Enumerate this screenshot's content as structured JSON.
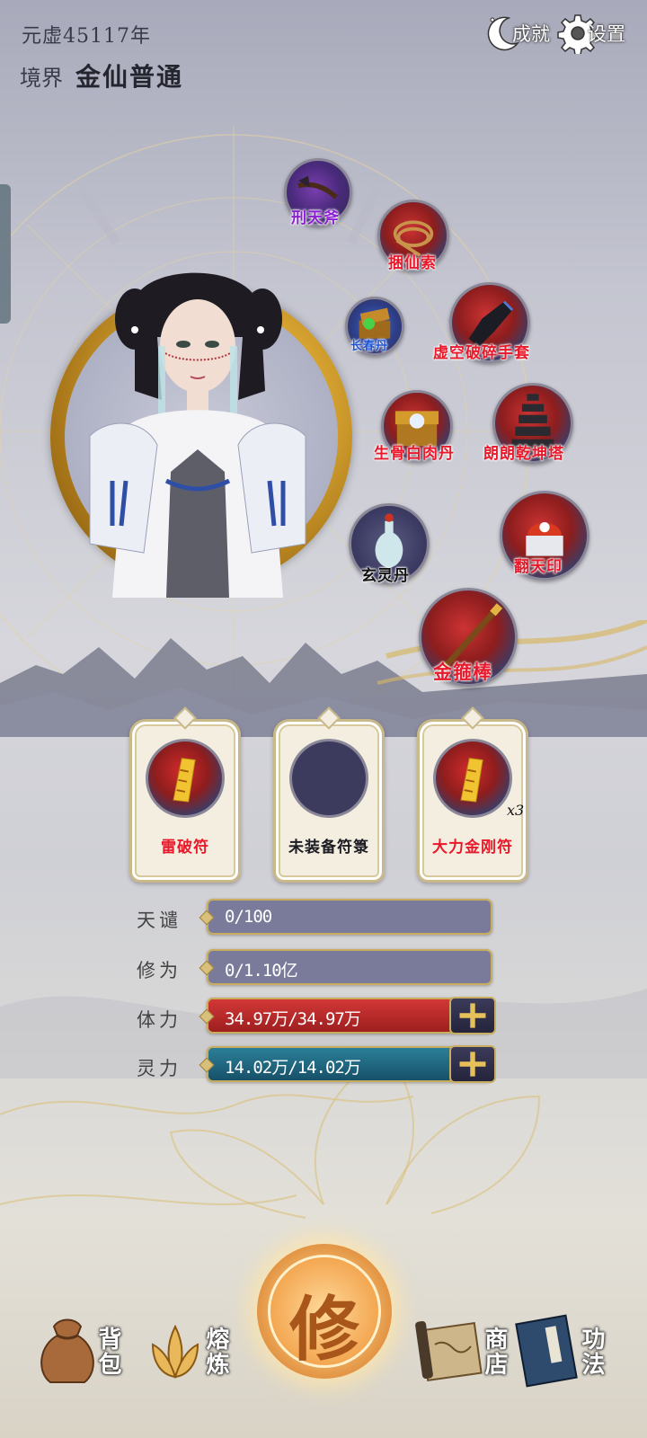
{
  "header": {
    "year": "元虚45117年",
    "realm_label": "境界",
    "realm_value": "金仙普通"
  },
  "top_buttons": {
    "achievements": "成就",
    "settings": "设置"
  },
  "equipment": [
    {
      "name": "刑天斧",
      "color": "purple"
    },
    {
      "name": "捆仙索",
      "color": "red"
    },
    {
      "name": "长春丹",
      "color": "blue"
    },
    {
      "name": "虚空破碎手套",
      "color": "red"
    },
    {
      "name": "生骨白肉丹",
      "color": "red"
    },
    {
      "name": "朗朗乾坤塔",
      "color": "red"
    },
    {
      "name": "玄灵丹",
      "color": "dark"
    },
    {
      "name": "翻天印",
      "color": "red"
    },
    {
      "name": "金箍棒",
      "color": "red"
    }
  ],
  "talismans": [
    {
      "label": "雷破符",
      "count": ""
    },
    {
      "label": "未装备符箓",
      "count": ""
    },
    {
      "label": "大力金刚符",
      "count": "x3"
    }
  ],
  "stats": {
    "heaven_label": "天谴",
    "heaven_value": "0/100",
    "cultivation_label": "修为",
    "cultivation_value": "0/1.10亿",
    "stamina_label": "体力",
    "stamina_value": "34.97万/34.97万",
    "stamina_fraction": 1.0,
    "spirit_label": "灵力",
    "spirit_value": "14.02万/14.02万",
    "spirit_fraction": 1.0
  },
  "nav": {
    "bag": "背包",
    "smelt": "熔炼",
    "cultivate": "修",
    "shop": "商店",
    "skills": "功法"
  },
  "colors": {
    "name_red": "#e8192b",
    "name_purple": "#8b1fd1",
    "name_blue": "#1d53d4",
    "bar_gray": "#7a7b9b",
    "bar_red": "#a82a2a",
    "bar_teal": "#1c5c74",
    "gold": "#c9ad5e"
  }
}
